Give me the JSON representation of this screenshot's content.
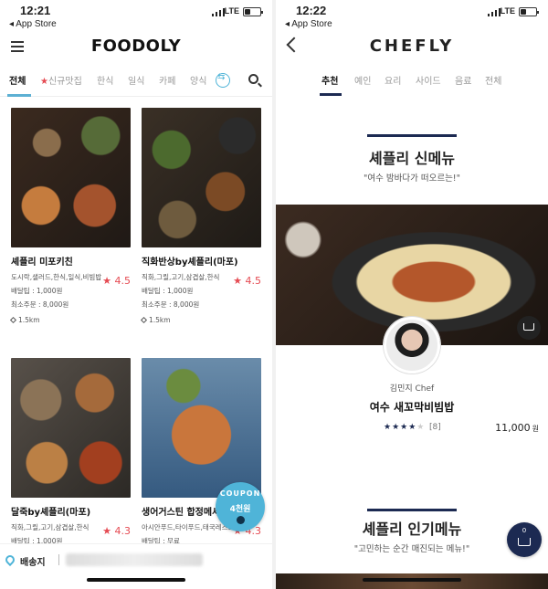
{
  "left": {
    "status": {
      "time": "12:21",
      "back_app": "◂ App Store",
      "network": "LTE"
    },
    "logo": "FOODOLY",
    "tabs": [
      {
        "label": "전체"
      },
      {
        "label": "신규맛집",
        "prefix_icon": "★"
      },
      {
        "label": "한식"
      },
      {
        "label": "일식"
      },
      {
        "label": "카페"
      },
      {
        "label": "양식"
      }
    ],
    "cards": [
      {
        "name": "셰플리 미포키친",
        "categories": "도시락,샐러드,한식,일식,비빔밥",
        "rating": "★ 4.5",
        "fee": "배달팁 : 1,000원",
        "min_order": "최소주문 : 8,000원",
        "distance": "1.5km"
      },
      {
        "name": "직화반상by셰플리(마포)",
        "categories": "직화,그릴,고기,삼겹살,한식",
        "rating": "★ 4.5",
        "fee": "배달팁 : 1,000원",
        "min_order": "최소주문 : 8,000원",
        "distance": "1.5km"
      },
      {
        "name": "달죽by셰플리(마포)",
        "categories": "직화,그릴,고기,삼겹살,한식",
        "rating": "★ 4.3",
        "fee": "배달팁 : 1,000원"
      },
      {
        "name": "생어거스틴 합정메세나",
        "categories": "아시안푸드,타이푸드,태국레스토랑",
        "rating": "★ 4.3",
        "fee": "배달팁 : 무료"
      }
    ],
    "coupon": {
      "label": "COUPON",
      "amount": "4천원"
    },
    "bottom": {
      "delivery_label": "배송지"
    }
  },
  "right": {
    "status": {
      "time": "12:22",
      "back_app": "◂ App Store",
      "network": "LTE"
    },
    "logo": "CHEFLY",
    "tabs": [
      {
        "label": "추천"
      },
      {
        "label": "예인"
      },
      {
        "label": "요리"
      },
      {
        "label": "사이드"
      },
      {
        "label": "음료"
      },
      {
        "label": "전체"
      }
    ],
    "new_menu": {
      "title": "셰플리 신메뉴",
      "subtitle": "\"여수 밤바다가 떠오르는!\""
    },
    "featured": {
      "chef": "김민지 Chef",
      "name": "여수 새꼬막비빔밥",
      "stars_filled": 4,
      "stars_total": 5,
      "reviews": "[8]",
      "price": "11,000",
      "currency": "원"
    },
    "popular": {
      "title": "셰플리 인기메뉴",
      "subtitle": "\"고민하는 순간 매진되는 메뉴!\""
    },
    "cart": {
      "count": "0"
    }
  },
  "colors": {
    "foodly_accent": "#4fb4d8",
    "rating_red": "#e54a52",
    "chefly_navy": "#1c2a52"
  }
}
